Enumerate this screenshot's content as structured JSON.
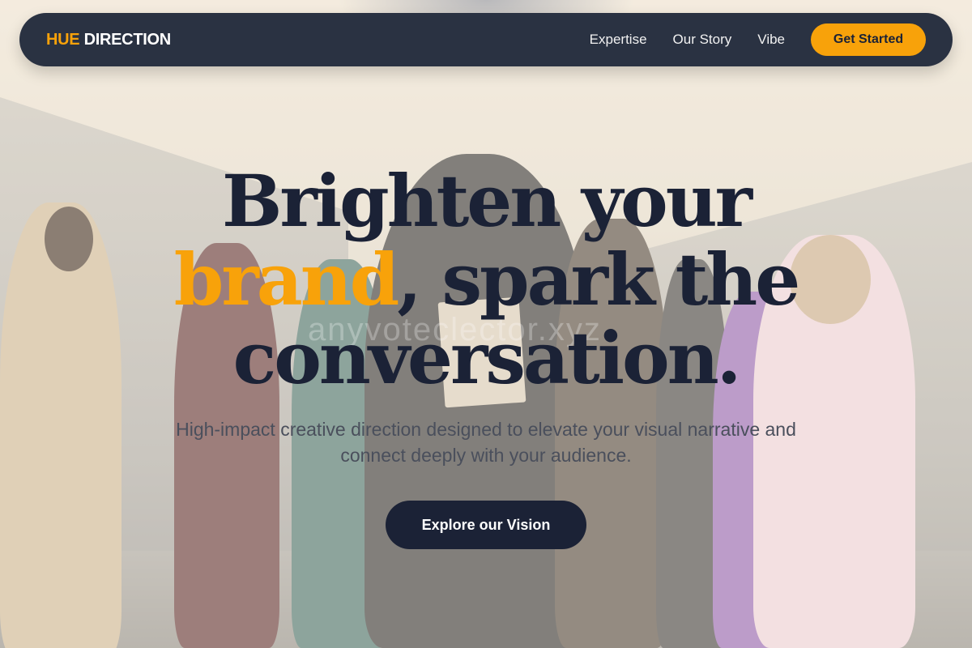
{
  "brand": {
    "accent": "HUE",
    "main": "DIRECTION"
  },
  "nav": {
    "links": [
      {
        "label": "Expertise"
      },
      {
        "label": "Our Story"
      },
      {
        "label": "Vibe"
      }
    ],
    "cta_label": "Get Started"
  },
  "hero": {
    "title_line1": "Brighten your",
    "title_highlight": "brand",
    "title_line2_rest": ", spark the",
    "title_line3": "conversation.",
    "subtitle": "High-impact creative direction designed to elevate your visual narrative and connect deeply with your audience.",
    "button_label": "Explore our Vision"
  },
  "colors": {
    "accent": "#f8a20a",
    "navy": "#1b2236",
    "nav_bg": "#2a3242"
  },
  "watermark": "anyvoteclector.xyz"
}
